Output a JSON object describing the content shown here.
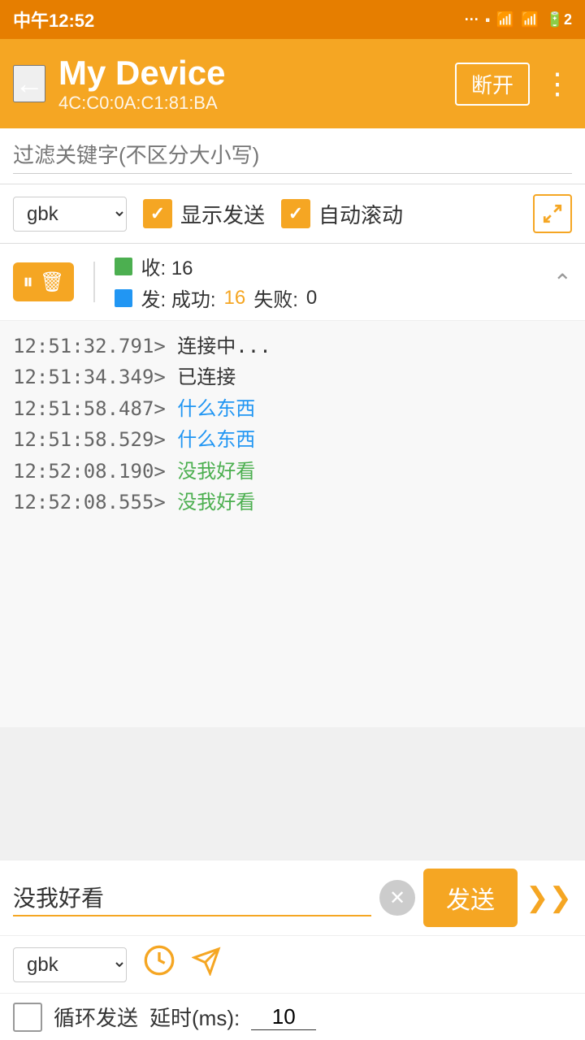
{
  "status_bar": {
    "time": "中午12:52",
    "battery": "2"
  },
  "toolbar": {
    "title": "My Device",
    "subtitle": "4C:C0:0A:C1:81:BA",
    "btn_disconnect": "断开",
    "back_icon": "←",
    "more_icon": "⋮"
  },
  "filter": {
    "placeholder": "过滤关键字(不区分大小写)"
  },
  "controls": {
    "encoding": "gbk",
    "show_send_label": "显示发送",
    "auto_scroll_label": "自动滚动"
  },
  "stats": {
    "recv_label": "收: 16",
    "send_label": "发: 成功: 16 失败: 0",
    "recv_count": "16",
    "send_success": "16",
    "send_fail": "0"
  },
  "logs": [
    {
      "time": "12:51:32.791>",
      "text": " 连接中...",
      "color": "default"
    },
    {
      "time": "12:51:34.349>",
      "text": " 已连接",
      "color": "default"
    },
    {
      "time": "12:51:58.487>",
      "text": " 什么东西",
      "color": "blue"
    },
    {
      "time": "12:51:58.529>",
      "text": " 什么东西",
      "color": "blue"
    },
    {
      "time": "12:52:08.190>",
      "text": " 没我好看",
      "color": "green"
    },
    {
      "time": "12:52:08.555>",
      "text": " 没我好看",
      "color": "green"
    }
  ],
  "input": {
    "message": "没我好看",
    "send_btn": "发送",
    "encoding": "gbk"
  },
  "loop": {
    "label": "循环发送",
    "delay_label": "延时(ms):",
    "delay_value": "10"
  }
}
